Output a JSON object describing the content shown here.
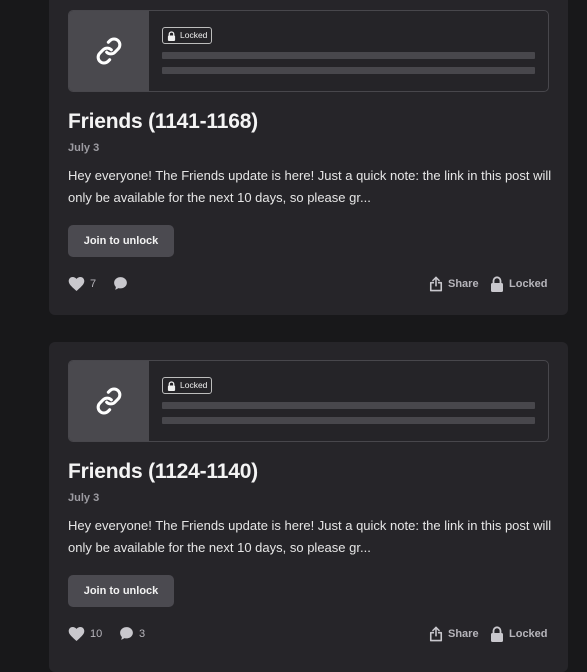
{
  "posts": [
    {
      "badge": "Locked",
      "title": "Friends (1141-1168)",
      "date": "July 3",
      "excerpt": "Hey everyone! The Friends update is here! Just a quick note: the link in this post will only be available for the next 10 days, so please gr...",
      "join_label": "Join to unlock",
      "likes": "7",
      "comments": "",
      "share_label": "Share",
      "locked_label": "Locked",
      "icons": [
        "link-icon",
        "lock-icon",
        "heart-icon",
        "comment-icon",
        "share-icon",
        "lock-icon"
      ]
    },
    {
      "badge": "Locked",
      "title": "Friends (1124-1140)",
      "date": "July 3",
      "excerpt": "Hey everyone! The Friends update is here! Just a quick note: the link in this post will only be available for the next 10 days, so please gr...",
      "join_label": "Join to unlock",
      "likes": "10",
      "comments": "3",
      "share_label": "Share",
      "locked_label": "Locked",
      "icons": [
        "link-icon",
        "lock-icon",
        "heart-icon",
        "comment-icon",
        "share-icon",
        "lock-icon"
      ]
    }
  ],
  "colors": {
    "background": "#18181a",
    "card": "#262529",
    "button": "#4b4a50",
    "muted_text": "#b6b5bb"
  }
}
